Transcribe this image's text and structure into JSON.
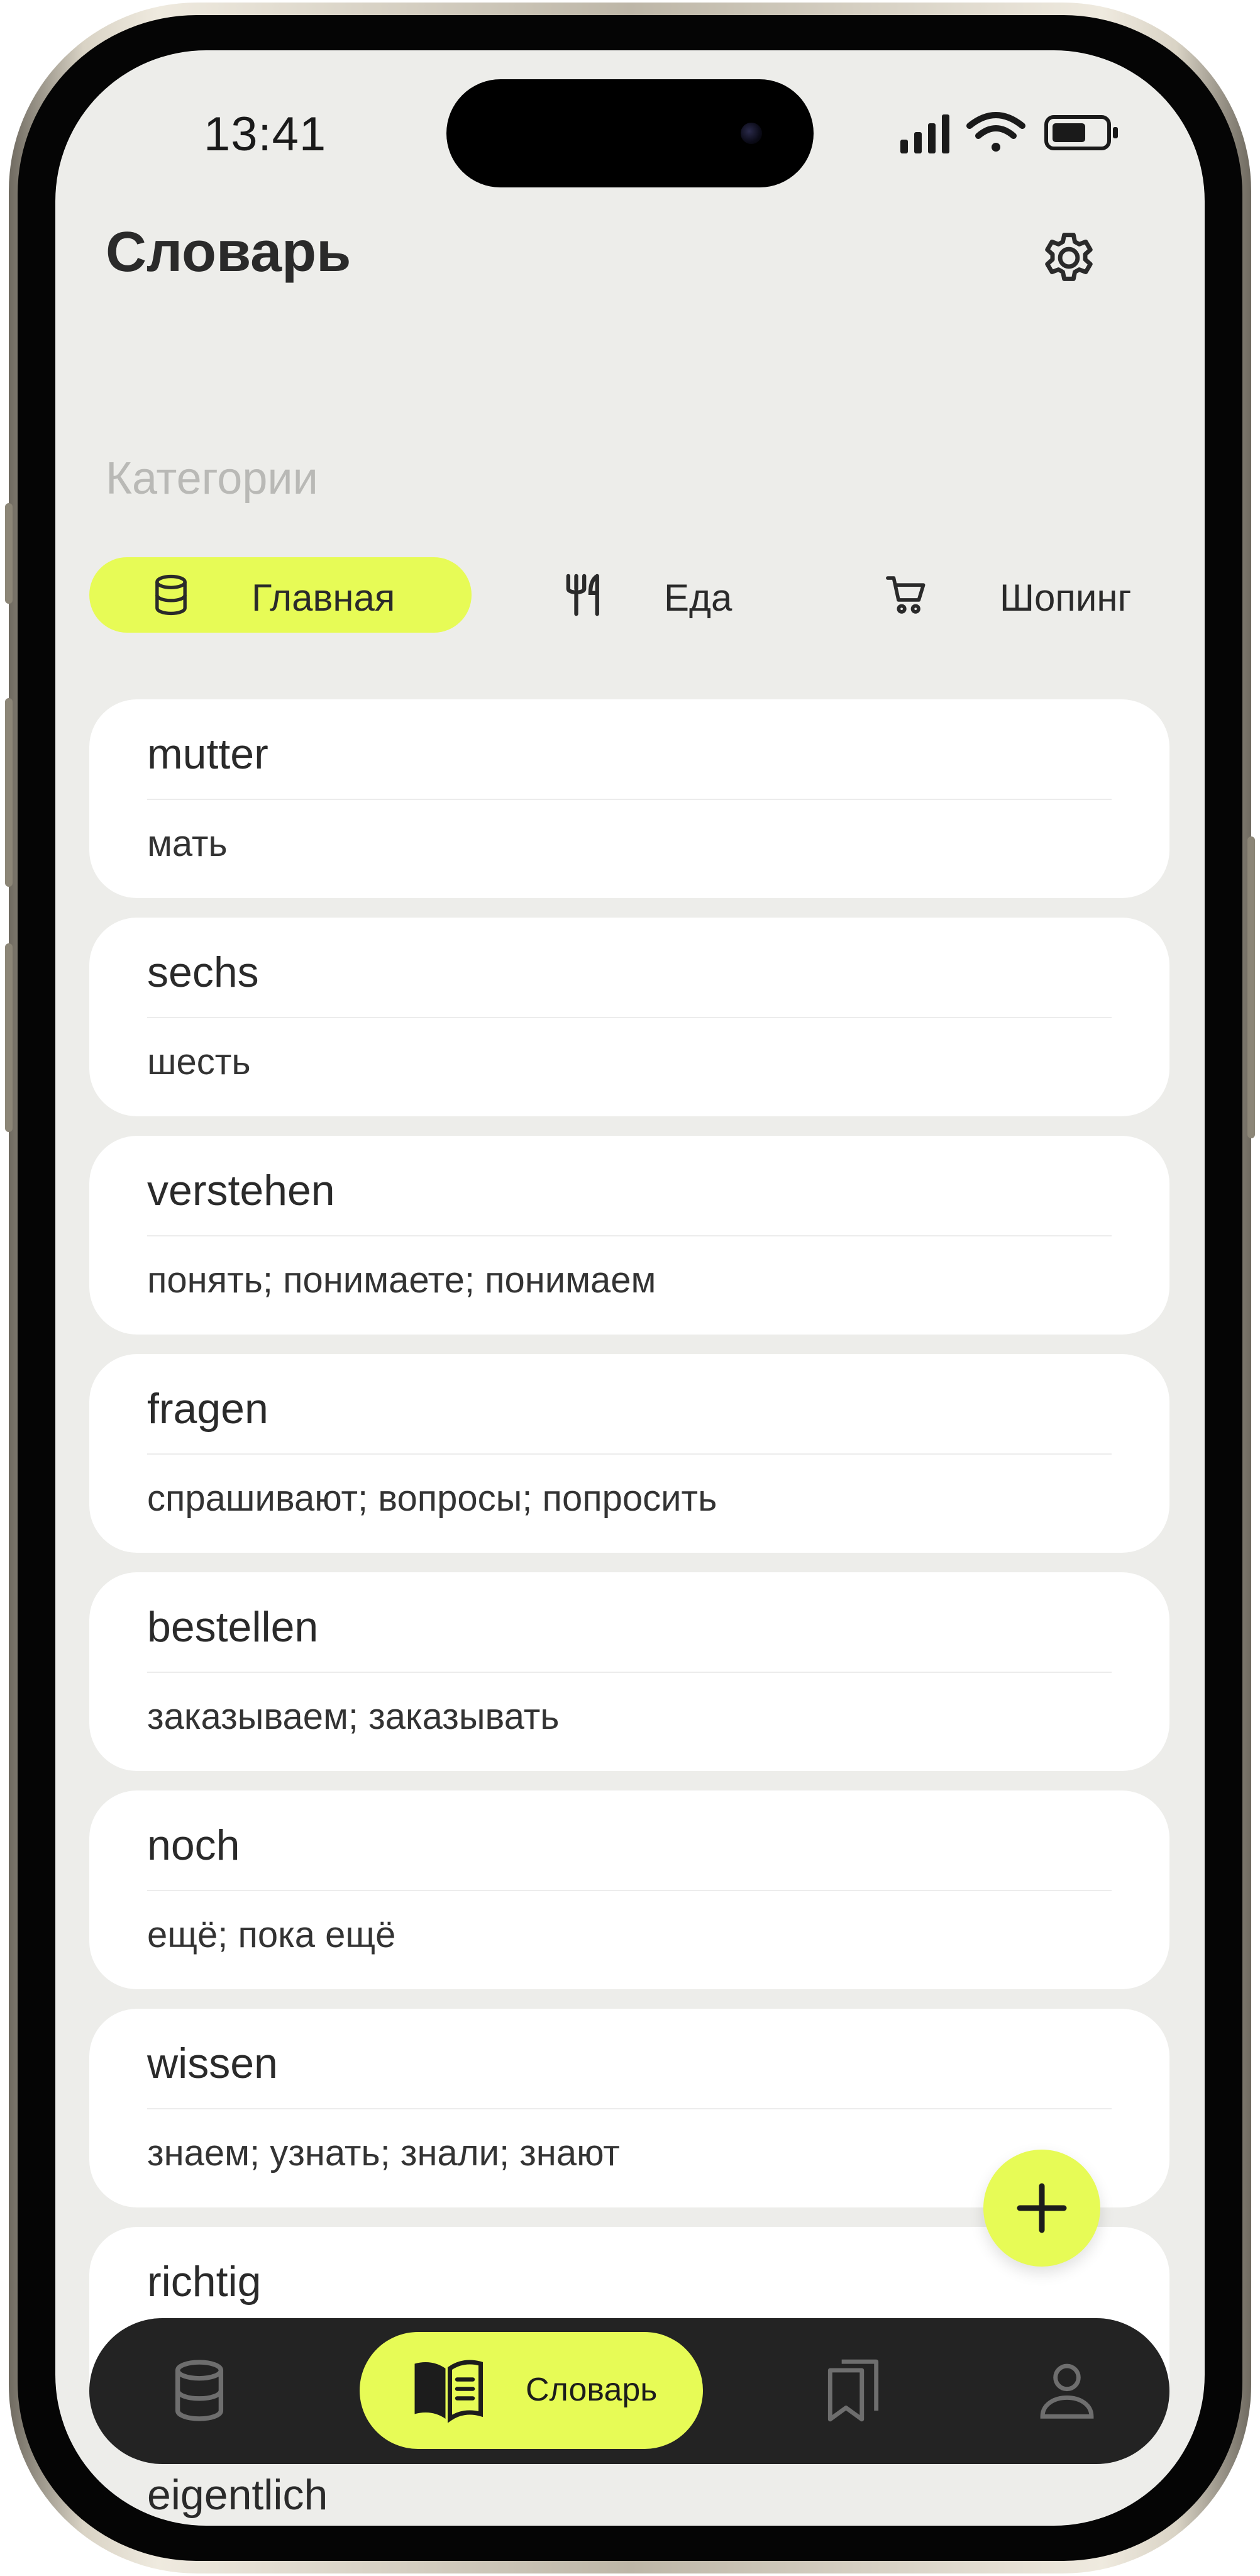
{
  "status_bar": {
    "time": "13:41"
  },
  "header": {
    "title": "Словарь"
  },
  "categories": {
    "label": "Категории",
    "items": [
      {
        "label": "Главная",
        "icon": "database-icon",
        "active": true
      },
      {
        "label": "Еда",
        "icon": "fork-knife-icon",
        "active": false
      },
      {
        "label": "Шопинг",
        "icon": "cart-icon",
        "active": false
      }
    ]
  },
  "words": [
    {
      "word": "mutter",
      "translation": "мать"
    },
    {
      "word": "sechs",
      "translation": "шесть"
    },
    {
      "word": "verstehen",
      "translation": "понять; понимаете; понимаем"
    },
    {
      "word": "fragen",
      "translation": "спрашивают; вопросы; попросить"
    },
    {
      "word": "bestellen",
      "translation": "заказываем; заказывать"
    },
    {
      "word": "noch",
      "translation": "ещё; пока ещё"
    },
    {
      "word": "wissen",
      "translation": "знаем; узнать; знали; знают"
    },
    {
      "word": "richtig",
      "translation": ""
    },
    {
      "word": "eigentlich",
      "translation": ""
    }
  ],
  "bottom_nav": {
    "items": [
      {
        "icon": "database-icon",
        "label": ""
      },
      {
        "icon": "open-book-icon",
        "label": "Словарь",
        "active": true
      },
      {
        "icon": "bookmarks-icon",
        "label": ""
      },
      {
        "icon": "person-icon",
        "label": ""
      }
    ]
  },
  "colors": {
    "accent": "#e7fb56",
    "background": "#ededea",
    "card": "#ffffff",
    "nav": "#232323",
    "text": "#2a2a2a",
    "muted": "#b9b9b6"
  }
}
